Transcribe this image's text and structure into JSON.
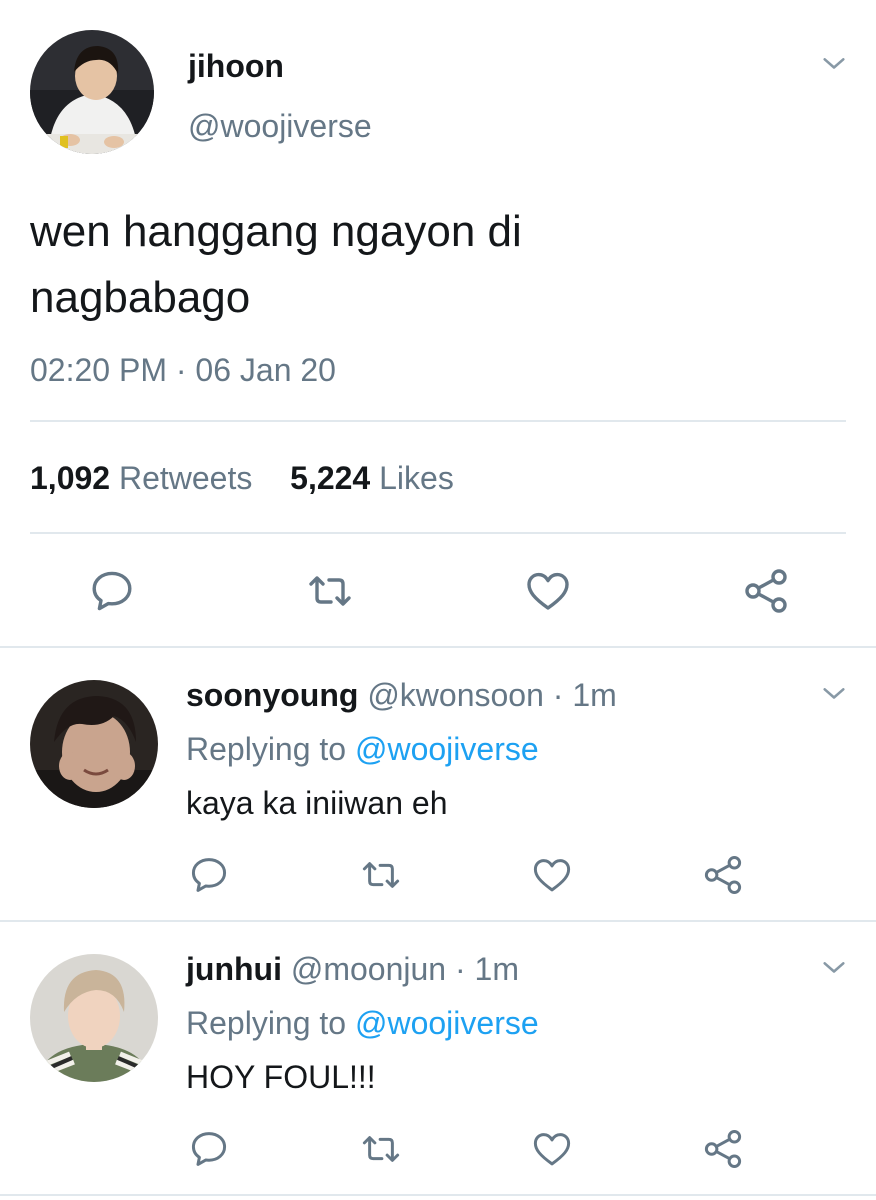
{
  "main_tweet": {
    "author_name": "jihoon",
    "handle": "@woojiverse",
    "text_line1": "wen hanggang ngayon di",
    "text_line2": "nagbabago",
    "timestamp": "02:20 PM · 06 Jan 20",
    "retweet_count": "1,092",
    "retweet_label": "Retweets",
    "like_count": "5,224",
    "like_label": "Likes"
  },
  "replies": [
    {
      "name": "soonyoung",
      "handle": "@kwonsoon",
      "time": "· 1m",
      "replying_label": "Replying to",
      "replying_to": "@woojiverse",
      "text": "kaya ka iniiwan eh"
    },
    {
      "name": "junhui",
      "handle": "@moonjun",
      "time": "· 1m",
      "replying_label": "Replying to",
      "replying_to": "@woojiverse",
      "text": "HOY FOUL!!!"
    }
  ],
  "icons": {
    "reply": "reply-icon",
    "retweet": "retweet-icon",
    "like": "heart-icon",
    "share": "share-icon",
    "menu": "chevron-down-icon"
  },
  "colors": {
    "text": "#14171a",
    "muted": "#657786",
    "link": "#1da1f2",
    "divider": "#e1e8ed"
  }
}
